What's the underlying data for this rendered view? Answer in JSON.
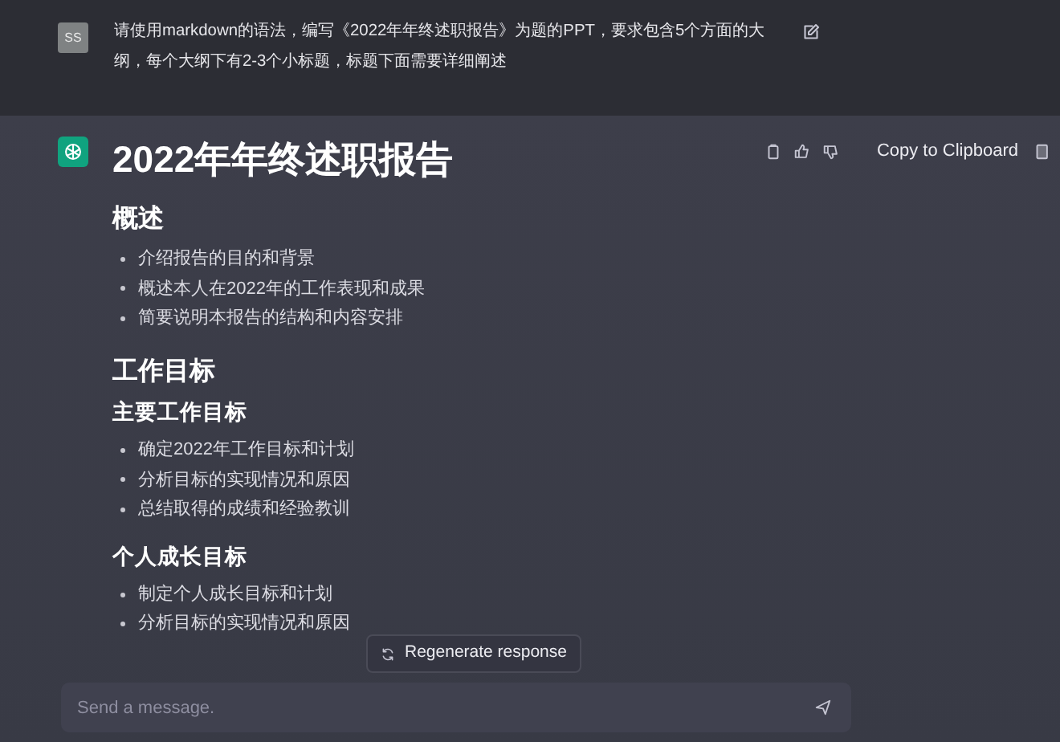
{
  "user_message": {
    "avatar": "SS",
    "text": "请使用markdown的语法，编写《2022年年终述职报告》为题的PPT，要求包含5个方面的大纲，每个大纲下有2-3个小标题，标题下面需要详细阐述"
  },
  "response": {
    "title": "2022年年终述职报告",
    "copy_label": "Copy to Clipboard",
    "blocks": [
      {
        "kind": "h2",
        "text": "概述"
      },
      {
        "kind": "bullets",
        "items": [
          "介绍报告的目的和背景",
          "概述本人在2022年的工作表现和成果",
          "简要说明本报告的结构和内容安排"
        ]
      },
      {
        "kind": "h2",
        "text": "工作目标"
      },
      {
        "kind": "h3",
        "text": "主要工作目标"
      },
      {
        "kind": "bullets",
        "items": [
          "确定2022年工作目标和计划",
          "分析目标的实现情况和原因",
          "总结取得的成绩和经验教训"
        ]
      },
      {
        "kind": "h3",
        "text": "个人成长目标"
      },
      {
        "kind": "bullets",
        "items": [
          "制定个人成长目标和计划",
          "分析目标的实现情况和原因"
        ]
      }
    ]
  },
  "regenerate_label": "Regenerate response",
  "composer": {
    "placeholder": "Send a message."
  }
}
